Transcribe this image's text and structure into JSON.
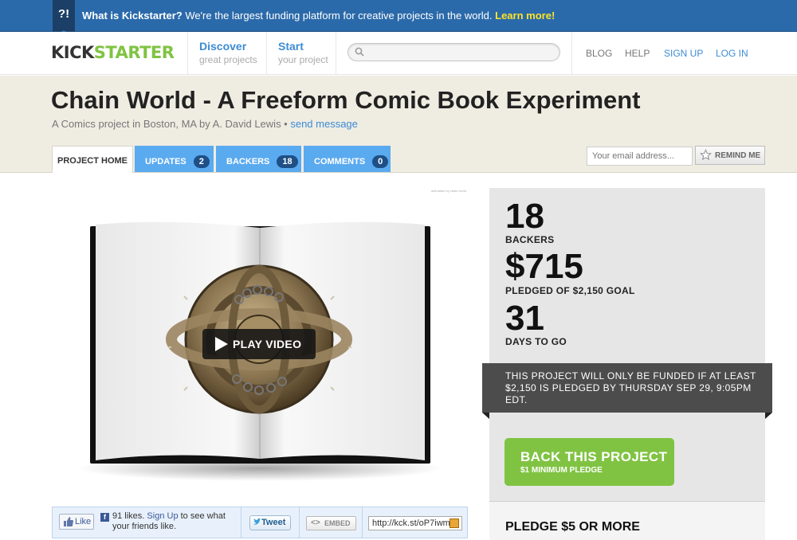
{
  "infobar": {
    "icon_label": "?!",
    "question": "What is Kickstarter?",
    "message": " We're the largest funding platform for creative projects in the world. ",
    "learn_more": "Learn more!"
  },
  "header": {
    "logo_part1": "KICK",
    "logo_part2": "STARTER",
    "discover": {
      "title": "Discover",
      "subtitle": "great projects"
    },
    "start": {
      "title": "Start",
      "subtitle": "your project"
    },
    "search_placeholder": "",
    "links": {
      "blog": "BLOG",
      "help": "HELP",
      "signup": "SIGN UP",
      "login": "LOG IN"
    }
  },
  "project": {
    "title": "Chain World - A Freeform Comic Book Experiment",
    "subtitle": "A Comics project in Boston, MA by A. David Lewis • ",
    "send_message": "send message"
  },
  "tabs": [
    {
      "label": "PROJECT HOME",
      "count": null
    },
    {
      "label": "UPDATES",
      "count": "2"
    },
    {
      "label": "BACKERS",
      "count": "18"
    },
    {
      "label": "COMMENTS",
      "count": "0"
    }
  ],
  "remind": {
    "email_placeholder": "Your email address...",
    "button": "REMIND ME"
  },
  "video": {
    "play_label": "PLAY VIDEO",
    "credit": "animation by chain world"
  },
  "share": {
    "like_label": "Like",
    "fb_icon": "f",
    "likes_count_text": "91 likes.",
    "signup_link": "Sign Up",
    "likes_suffix": " to see what your friends like.",
    "tweet_label": "Tweet",
    "embed_label": "EMBED",
    "embed_icon": "<>",
    "short_url": "http://kck.st/oP7iwm"
  },
  "stats": {
    "backers_count": "18",
    "backers_label": "BACKERS",
    "pledged_amount": "$715",
    "pledged_label": "PLEDGED OF $2,150 GOAL",
    "days_count": "31",
    "days_label": "DAYS TO GO",
    "funding_note": "THIS PROJECT WILL ONLY BE FUNDED IF AT LEAST $2,150 IS PLEDGED BY THURSDAY SEP 29, 9:05PM EDT.",
    "back_button": "BACK THIS PROJECT",
    "back_button_sub": "$1 MINIMUM PLEDGE",
    "pledge_tier_heading": "PLEDGE $5 OR MORE"
  },
  "colors": {
    "brand_green": "#80c343",
    "link_blue": "#3d8cd5",
    "infobar_blue": "#2b6aaa",
    "tab_blue": "#5aaaf0",
    "band_beige": "#efece2"
  }
}
